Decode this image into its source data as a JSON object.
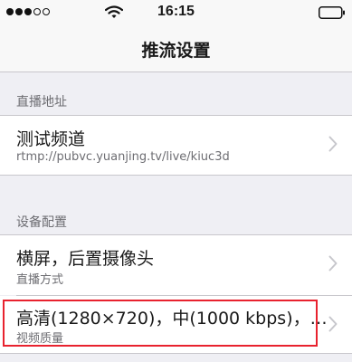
{
  "status_bar": {
    "time": "16:15",
    "signal_icon": "signal-dots-icon",
    "wifi_icon": "wifi-icon",
    "battery_icon": "battery-icon"
  },
  "nav": {
    "title": "推流设置"
  },
  "sections": [
    {
      "header": "直播地址",
      "rows": [
        {
          "primary": "测试频道",
          "secondary": "rtmp://pubvc.yuanjing.tv/live/kiuc3d"
        }
      ]
    },
    {
      "header": "设备配置",
      "rows": [
        {
          "primary": "横屏，后置摄像头",
          "secondary": "直播方式"
        },
        {
          "primary": "高清(1280×720)，中(1000 kbps)，…",
          "secondary": "视频质量"
        }
      ]
    }
  ],
  "colors": {
    "background": "#efeff4",
    "cell": "#ffffff",
    "secondary_text": "#6d6d72",
    "highlight": "#e8222e"
  }
}
